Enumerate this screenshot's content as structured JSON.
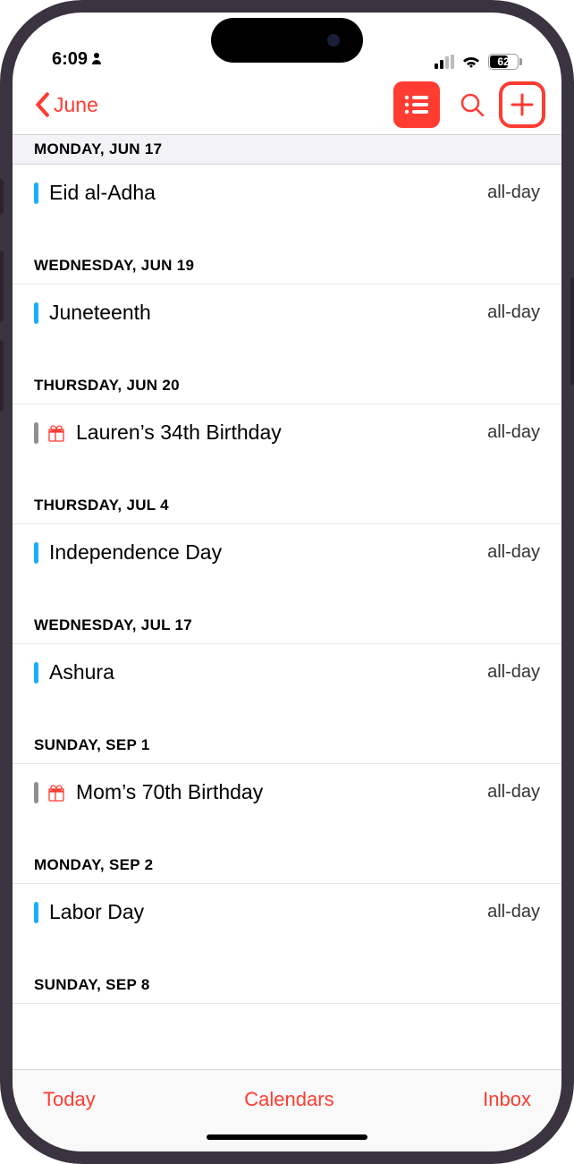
{
  "status": {
    "time": "6:09",
    "battery": "62"
  },
  "nav": {
    "back_label": "June"
  },
  "colors": {
    "accent": "#fe3c31",
    "cal_blue": "#1aaef8",
    "cal_gray": "#8e8e93"
  },
  "days": [
    {
      "header": "MONDAY, JUN 17",
      "events": [
        {
          "title": "Eid al-Adha",
          "time": "all-day",
          "color": "cal_blue",
          "icon": null
        }
      ]
    },
    {
      "header": "WEDNESDAY, JUN 19",
      "events": [
        {
          "title": "Juneteenth",
          "time": "all-day",
          "color": "cal_blue",
          "icon": null
        }
      ]
    },
    {
      "header": "THURSDAY, JUN 20",
      "events": [
        {
          "title": "Lauren’s 34th Birthday",
          "time": "all-day",
          "color": "cal_gray",
          "icon": "gift"
        }
      ]
    },
    {
      "header": "THURSDAY, JUL 4",
      "events": [
        {
          "title": "Independence Day",
          "time": "all-day",
          "color": "cal_blue",
          "icon": null
        }
      ]
    },
    {
      "header": "WEDNESDAY, JUL 17",
      "events": [
        {
          "title": "Ashura",
          "time": "all-day",
          "color": "cal_blue",
          "icon": null
        }
      ]
    },
    {
      "header": "SUNDAY, SEP 1",
      "events": [
        {
          "title": "Mom’s 70th Birthday",
          "time": "all-day",
          "color": "cal_gray",
          "icon": "gift"
        }
      ]
    },
    {
      "header": "MONDAY, SEP 2",
      "events": [
        {
          "title": "Labor Day",
          "time": "all-day",
          "color": "cal_blue",
          "icon": null
        }
      ]
    },
    {
      "header": "SUNDAY, SEP 8",
      "events": []
    }
  ],
  "toolbar": {
    "today": "Today",
    "calendars": "Calendars",
    "inbox": "Inbox"
  }
}
